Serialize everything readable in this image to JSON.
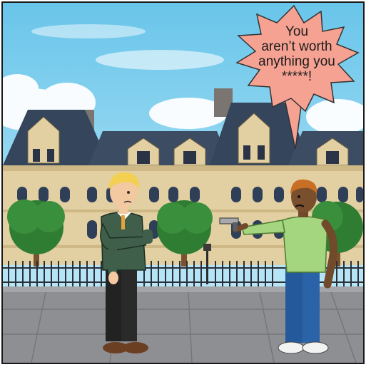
{
  "speech_bubble": {
    "lines": [
      "You",
      "aren’t worth",
      "anything you",
      "*****!"
    ]
  },
  "colors": {
    "sky_top": "#69c5ea",
    "building": "#e2cfa2",
    "roof": "#34455c",
    "bubble": "#f5a293",
    "ground": "#8d8f92",
    "sweater": "#3f5f4a",
    "shirt_green": "#a4d67f",
    "jeans": "#24599b"
  }
}
